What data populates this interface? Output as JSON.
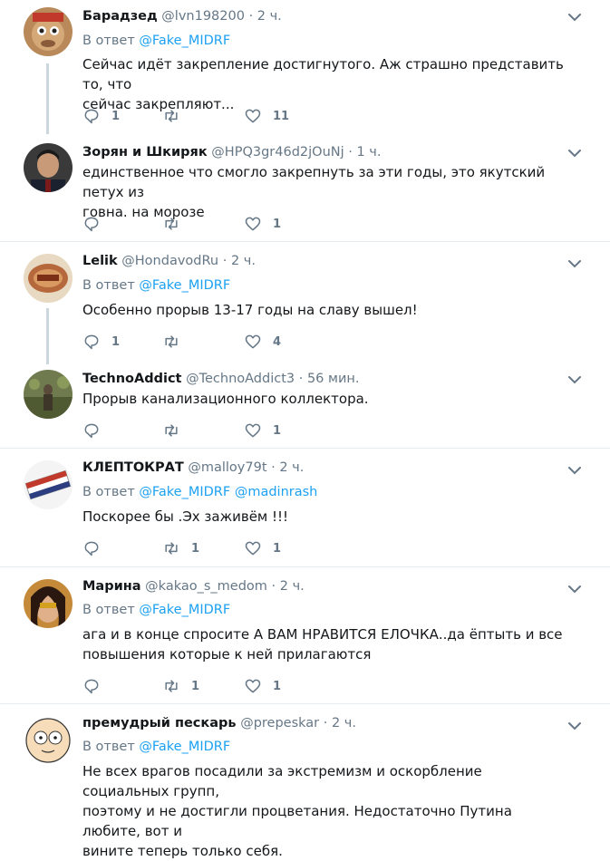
{
  "tweets": [
    {
      "name": "Барадзед",
      "handle": "@lvn198200",
      "dot": "·",
      "time": "2 ч.",
      "reply_prefix": "В ответ",
      "mentions": [
        "@Fake_MIDRF"
      ],
      "text_lines": [
        "Сейчас идёт закрепление достигнутого. Аж страшно представить то, что",
        "сейчас закрепляют..."
      ],
      "replies": "1",
      "retweets": "",
      "likes": "11"
    },
    {
      "name": "Зорян и Шкиряк",
      "handle": "@HPQ3gr46d2jOuNj",
      "dot": "·",
      "time": "1 ч.",
      "reply_prefix": "",
      "mentions": [],
      "text_lines": [
        "единственное что смогло закрепнуть за эти годы, это якутский петух из",
        "говна. на морозе"
      ],
      "replies": "",
      "retweets": "",
      "likes": "1"
    },
    {
      "name": "Lelik",
      "handle": "@HondavodRu",
      "dot": "·",
      "time": "2 ч.",
      "reply_prefix": "В ответ",
      "mentions": [
        "@Fake_MIDRF"
      ],
      "text_lines": [
        "Особенно прорыв 13-17 годы на славу вышел!"
      ],
      "replies": "1",
      "retweets": "",
      "likes": "4"
    },
    {
      "name": "TechnoAddict",
      "handle": "@TechnoAddict3",
      "dot": "·",
      "time": "56 мин.",
      "reply_prefix": "",
      "mentions": [],
      "text_lines": [
        "Прорыв канализационного коллектора."
      ],
      "replies": "",
      "retweets": "",
      "likes": "1"
    },
    {
      "name": "КЛЕПТОКРАТ",
      "handle": "@malloy79t",
      "dot": "·",
      "time": "2 ч.",
      "reply_prefix": "В ответ",
      "mentions": [
        "@Fake_MIDRF",
        "@madinrash"
      ],
      "text_lines": [
        "Поскорее бы .Эх заживём !!!"
      ],
      "replies": "",
      "retweets": "1",
      "likes": "1"
    },
    {
      "name": "Марина",
      "handle": "@kakao_s_medom",
      "dot": "·",
      "time": "2 ч.",
      "reply_prefix": "В ответ",
      "mentions": [
        "@Fake_MIDRF"
      ],
      "text_lines": [
        "ага и в конце спросите А ВАМ НРАВИТСЯ ЕЛОЧКА..да ёптыть и все",
        "повышения которые к ней прилагаются"
      ],
      "replies": "",
      "retweets": "1",
      "likes": "1"
    },
    {
      "name": "премудрый пескарь",
      "handle": "@prepeskar",
      "dot": "·",
      "time": "2 ч.",
      "reply_prefix": "В ответ",
      "mentions": [
        "@Fake_MIDRF"
      ],
      "text_lines": [
        "Не всех врагов посадили за экстремизм и оскорбление социальных групп,",
        "поэтому и не достигли процветания. Недостаточно Путина любите, вот и",
        "вините теперь только себя."
      ],
      "replies": "",
      "retweets": "",
      "likes": ""
    }
  ],
  "icons": {
    "reply": "reply-icon",
    "retweet": "retweet-icon",
    "like": "heart-icon",
    "menu": "chevron-down-icon"
  },
  "colors": {
    "link": "#1da1f2",
    "muted": "#657786",
    "text": "#14171a",
    "separator": "#e6ecf0"
  }
}
